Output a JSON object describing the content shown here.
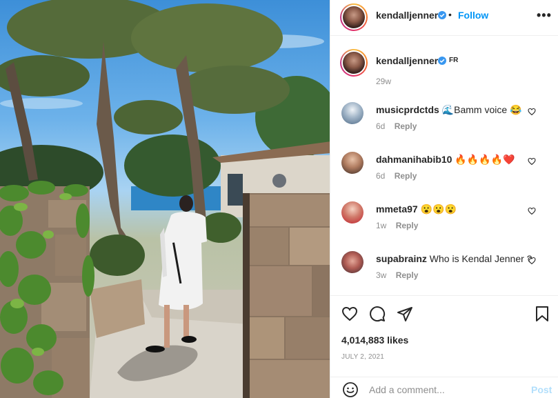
{
  "header": {
    "username": "kendalljenner",
    "separator": "•",
    "follow_label": "Follow",
    "more_label": "•••"
  },
  "caption": {
    "username": "kendalljenner",
    "flag_text": "FR",
    "age": "29w"
  },
  "comments": [
    {
      "username": "musicprdctds",
      "text": "🌊Bamm voice 😂",
      "age": "6d",
      "reply_label": "Reply"
    },
    {
      "username": "dahmanihabib10",
      "text": "🔥🔥🔥🔥❤️",
      "age": "6d",
      "reply_label": "Reply"
    },
    {
      "username": "mmeta97",
      "text": "😮😮😮",
      "age": "1w",
      "reply_label": "Reply"
    },
    {
      "username": "supabrainz",
      "text": "Who is Kendal Jenner ?",
      "age": "3w",
      "reply_label": "Reply"
    }
  ],
  "actions": {
    "likes": "4,014,883 likes",
    "date": "JULY 2, 2021"
  },
  "add_comment": {
    "placeholder": "Add a comment...",
    "post_label": "Post"
  },
  "icons": {
    "verified": "verified-badge-icon",
    "like": "heart-icon",
    "comment": "comment-bubble-icon",
    "share": "paper-plane-icon",
    "save": "bookmark-icon",
    "emoji": "smiley-icon"
  },
  "colors": {
    "link_blue": "#0095f6",
    "post_disabled": "#b2dffc",
    "muted_text": "#8e8e8e",
    "verified_blue": "#3897f0",
    "divider": "#efefef"
  }
}
